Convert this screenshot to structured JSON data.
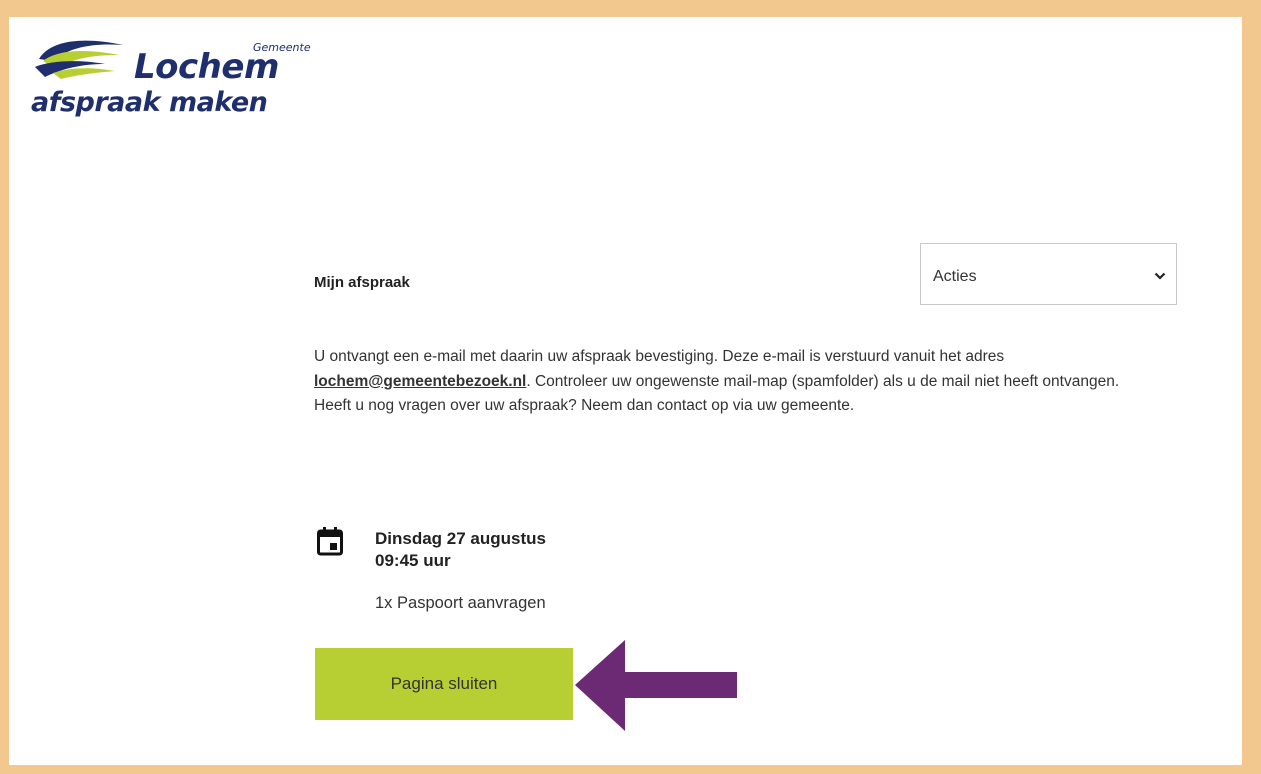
{
  "logo": {
    "gemeente": "Gemeente",
    "name": "Lochem",
    "tagline": "afspraak maken"
  },
  "appointment": {
    "title": "Mijn afspraak",
    "actions_select": "Acties",
    "info_line1": "U ontvangt een e-mail met daarin uw afspraak bevestiging. Deze e-mail is verstuurd vanuit het adres",
    "email_link": "lochem@gemeentebezoek.nl",
    "info_line2": ". Controleer uw ongewenste mail-map (spamfolder) als u de mail niet heeft ontvangen.",
    "info_line3": "Heeft u nog vragen over uw afspraak? Neem dan contact op via uw gemeente.",
    "date": "Dinsdag 27 augustus",
    "time": "09:45 uur",
    "service": "1x Paspoort aanvragen",
    "close_button": "Pagina sluiten"
  },
  "colors": {
    "frame": "#f3c88f",
    "button": "#b8cf34",
    "arrow": "#6b2a73",
    "brand_blue": "#1f2f6e",
    "brand_green": "#b8cf34"
  },
  "icons": {
    "calendar": "calendar-icon",
    "chevron": "chevron-down-icon",
    "arrow": "arrow-left-icon"
  }
}
